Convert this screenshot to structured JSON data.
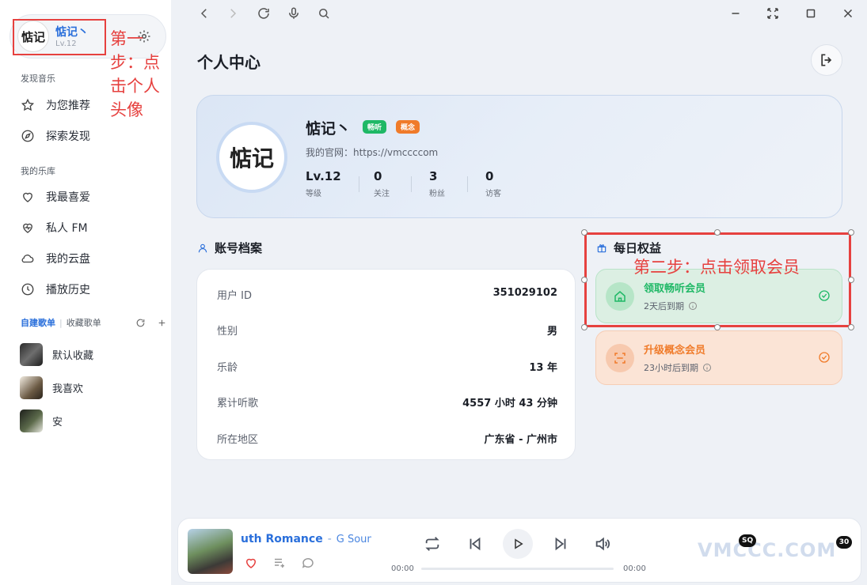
{
  "sidebar": {
    "user": {
      "avatar_text": "惦记",
      "name": "惦记丶",
      "level": "Lv.12"
    },
    "annotation_step1": "第一步：点击个人头像",
    "discover_title": "发现音乐",
    "discover_items": [
      {
        "label": "为您推荐",
        "icon": "star-icon"
      },
      {
        "label": "探索发现",
        "icon": "compass-icon"
      }
    ],
    "library_title": "我的乐库",
    "library_items": [
      {
        "label": "我最喜爱",
        "icon": "heart-icon"
      },
      {
        "label": "私人 FM",
        "icon": "heart-pulse-icon"
      },
      {
        "label": "我的云盘",
        "icon": "cloud-icon"
      },
      {
        "label": "播放历史",
        "icon": "clock-icon"
      }
    ],
    "playlist_tabs": {
      "created": "自建歌单",
      "collected": "收藏歌单"
    },
    "playlists": [
      {
        "label": "默认收藏"
      },
      {
        "label": "我喜欢"
      },
      {
        "label": "安"
      }
    ]
  },
  "page": {
    "title": "个人中心"
  },
  "profile": {
    "avatar_text": "惦记",
    "name": "惦记丶",
    "badge_vip": "畅听",
    "badge_concept": "概念",
    "site": "我的官网：https://vmccccom",
    "stats": [
      {
        "value": "Lv.12",
        "label": "等级"
      },
      {
        "value": "0",
        "label": "关注"
      },
      {
        "value": "3",
        "label": "粉丝"
      },
      {
        "value": "0",
        "label": "访客"
      }
    ]
  },
  "account": {
    "title": "账号档案",
    "rows": [
      {
        "label": "用户 ID",
        "value": "351029102"
      },
      {
        "label": "性别",
        "value": "男"
      },
      {
        "label": "乐龄",
        "value": "13 年"
      },
      {
        "label": "累计听歌",
        "value": "4557 小时 43 分钟"
      },
      {
        "label": "所在地区",
        "value": "广东省 - 广州市"
      }
    ]
  },
  "benefits": {
    "title": "每日权益",
    "annotation_step2": "第二步：点击领取会员",
    "items": [
      {
        "title": "领取畅听会员",
        "sub": "2天后到期",
        "color": "#1fb866"
      },
      {
        "title": "升级概念会员",
        "sub": "23小时后到期",
        "color": "#f07b2a"
      }
    ]
  },
  "player": {
    "track_title": "uth Romance",
    "track_artist": "G Sounds",
    "time_current": "00:00",
    "time_total": "00:00",
    "quality_badge": "SQ",
    "count_badge": "30",
    "watermark": "VMCCC.COM"
  },
  "colors": {
    "accent": "#2a6fdb",
    "annotation": "#e6413f",
    "green": "#1fb866",
    "orange": "#f07b2a"
  }
}
